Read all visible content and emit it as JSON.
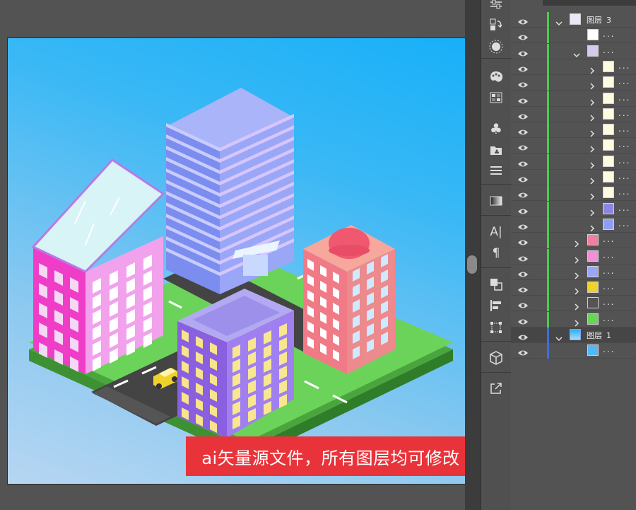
{
  "banner": {
    "text": "ai矢量源文件，所有图层均可修改"
  },
  "colors": {
    "panel_bg": "#535353",
    "layer3_color": "#4ccc4c",
    "layer1_color": "#3f6fd8",
    "banner_bg": "#e9333a",
    "sky_top": "#18b0f8",
    "sky_bottom": "#b7d6f2"
  },
  "toolbar": {
    "tools": [
      "sliders-icon",
      "transform-icon",
      "sun-icon",
      "palette-icon",
      "swatch-grid-icon",
      "club-icon",
      "library-icon",
      "menu-lines-icon",
      "gradient-icon",
      "character-icon",
      "paragraph-icon",
      "pathfinder-icon",
      "align-icon",
      "transform-box-icon",
      "3d-cube-icon",
      "export-icon"
    ]
  },
  "layers": {
    "layer3": {
      "name": "图层",
      "number": "3"
    },
    "layer1": {
      "name": "图层",
      "number": "1"
    },
    "sublayer_dots": "..."
  }
}
